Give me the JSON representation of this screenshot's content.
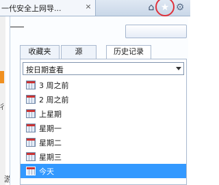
{
  "browser": {
    "tab_title": "一代安全上网导...",
    "tab_close": "×",
    "home_icon": "home-icon",
    "favorites_icon": "star-icon",
    "tools_icon": "gear-icon"
  },
  "background_page": {
    "left_glyph_1": "彳",
    "bottom_glyph": "游"
  },
  "panel": {
    "tabs": [
      {
        "label": "收藏夹"
      },
      {
        "label": "源"
      },
      {
        "label": "历史记录"
      }
    ],
    "active_tab": "历史记录",
    "view_select": {
      "value": "按日期查看"
    },
    "history_items": [
      {
        "label": "3 周之前"
      },
      {
        "label": "2 周之前"
      },
      {
        "label": "上星期"
      },
      {
        "label": "星期一"
      },
      {
        "label": "星期二"
      },
      {
        "label": "星期三"
      },
      {
        "label": "今天"
      }
    ],
    "selected_item": "今天"
  },
  "colors": {
    "selection": "#3399ff",
    "highlight_ring": "#e0303a",
    "chrome": "#c9d7e8"
  }
}
